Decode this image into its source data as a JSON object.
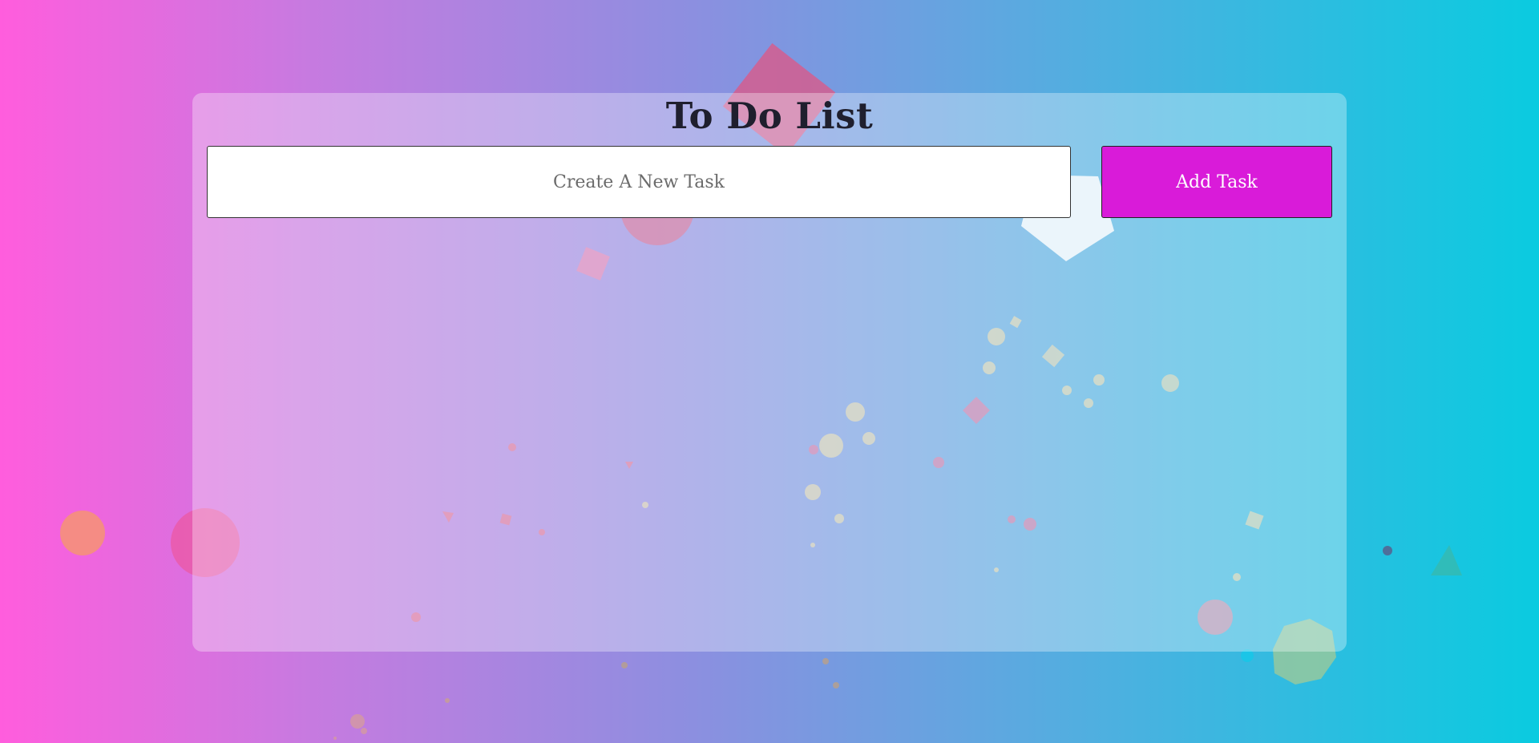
{
  "app": {
    "title": "To Do List"
  },
  "task_form": {
    "input_value": "",
    "input_placeholder": "Create A New Task",
    "add_button_label": "Add Task"
  },
  "tasks": [],
  "colors": {
    "background_gradient": [
      "#ff5ddd",
      "#c77ae0",
      "#8c8fe0",
      "#52aee0",
      "#0acbe0"
    ],
    "add_button": "#d91bd9",
    "input_background": "#ffffff",
    "title_text": "#1f1f2e"
  }
}
